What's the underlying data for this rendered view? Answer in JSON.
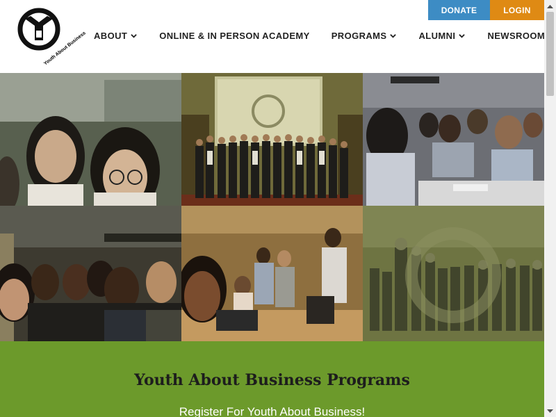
{
  "header": {
    "logo_text": "Youth About Business",
    "nav": [
      {
        "label": "ABOUT",
        "has_dropdown": true
      },
      {
        "label": "ONLINE & IN PERSON ACADEMY",
        "has_dropdown": false
      },
      {
        "label": "PROGRAMS",
        "has_dropdown": true
      },
      {
        "label": "ALUMNI",
        "has_dropdown": true
      },
      {
        "label": "NEWSROOM",
        "has_dropdown": false
      }
    ],
    "donate_label": "DONATE",
    "login_label": "LOGIN"
  },
  "colors": {
    "donate": "#3d8cc4",
    "login": "#df8a14",
    "band": "#6c9a2b"
  },
  "gallery": {
    "photos": [
      {
        "name": "students-selfie-street",
        "icon": "photo"
      },
      {
        "name": "group-photo-stage",
        "icon": "photo"
      },
      {
        "name": "students-in-class",
        "icon": "photo"
      },
      {
        "name": "subway-group-selfie",
        "icon": "photo"
      },
      {
        "name": "office-team-selfie",
        "icon": "photo"
      },
      {
        "name": "group-event-overlay",
        "icon": "photo"
      }
    ]
  },
  "band": {
    "title": "Youth About Business Programs",
    "subtitle": "Register For Youth About Business!"
  }
}
